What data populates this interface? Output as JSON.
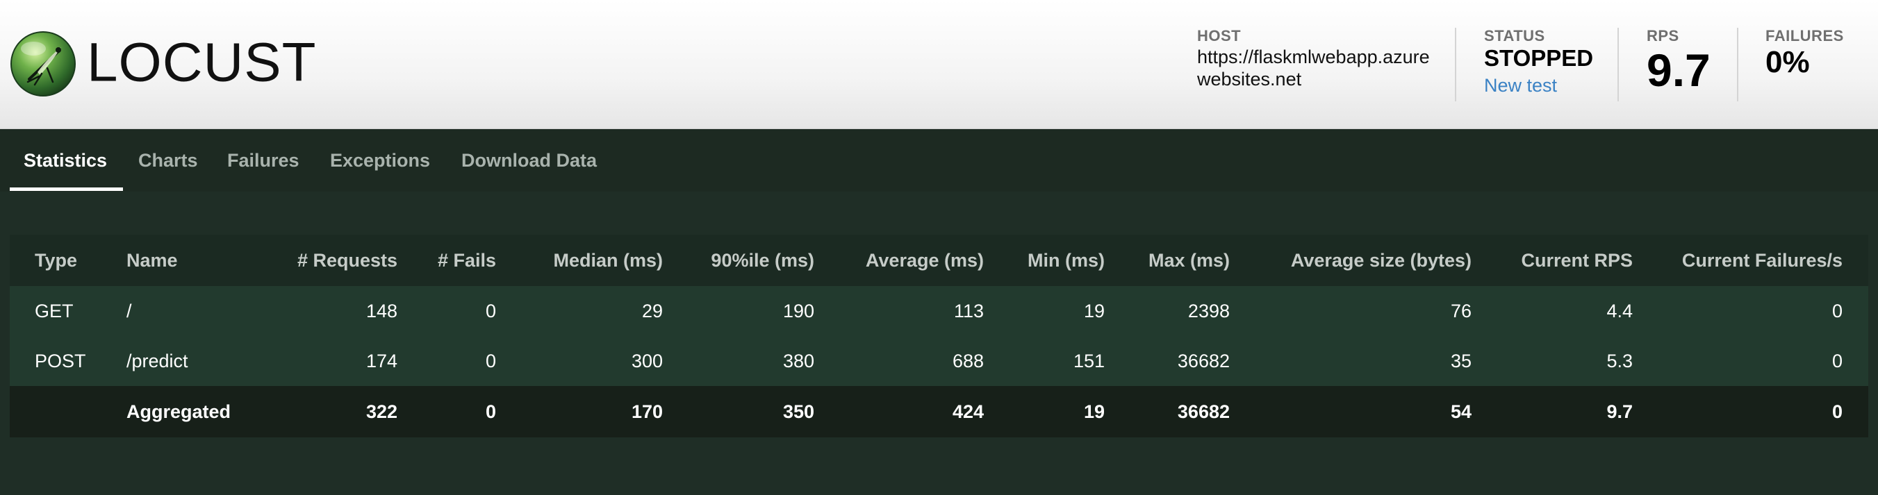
{
  "header": {
    "brand": "LOCUST",
    "host_label": "HOST",
    "host_value": "https://flaskmlwebapp.azurewebsites.net",
    "status_label": "STATUS",
    "status_value": "STOPPED",
    "new_test_label": "New test",
    "rps_label": "RPS",
    "rps_value": "9.7",
    "failures_label": "FAILURES",
    "failures_value": "0%"
  },
  "tabs": [
    {
      "label": "Statistics",
      "active": true
    },
    {
      "label": "Charts",
      "active": false
    },
    {
      "label": "Failures",
      "active": false
    },
    {
      "label": "Exceptions",
      "active": false
    },
    {
      "label": "Download Data",
      "active": false
    }
  ],
  "table": {
    "columns": [
      "Type",
      "Name",
      "# Requests",
      "# Fails",
      "Median (ms)",
      "90%ile (ms)",
      "Average (ms)",
      "Min (ms)",
      "Max (ms)",
      "Average size (bytes)",
      "Current RPS",
      "Current Failures/s"
    ],
    "rows": [
      [
        "GET",
        "/",
        "148",
        "0",
        "29",
        "190",
        "113",
        "19",
        "2398",
        "76",
        "4.4",
        "0"
      ],
      [
        "POST",
        "/predict",
        "174",
        "0",
        "300",
        "380",
        "688",
        "151",
        "36682",
        "35",
        "5.3",
        "0"
      ]
    ],
    "aggregated": [
      "",
      "Aggregated",
      "322",
      "0",
      "170",
      "350",
      "424",
      "19",
      "36682",
      "54",
      "9.7",
      "0"
    ]
  },
  "colors": {
    "background": "#1f2e26",
    "accent_link": "#3b82c4",
    "header_bg": "#f4f4f4"
  }
}
